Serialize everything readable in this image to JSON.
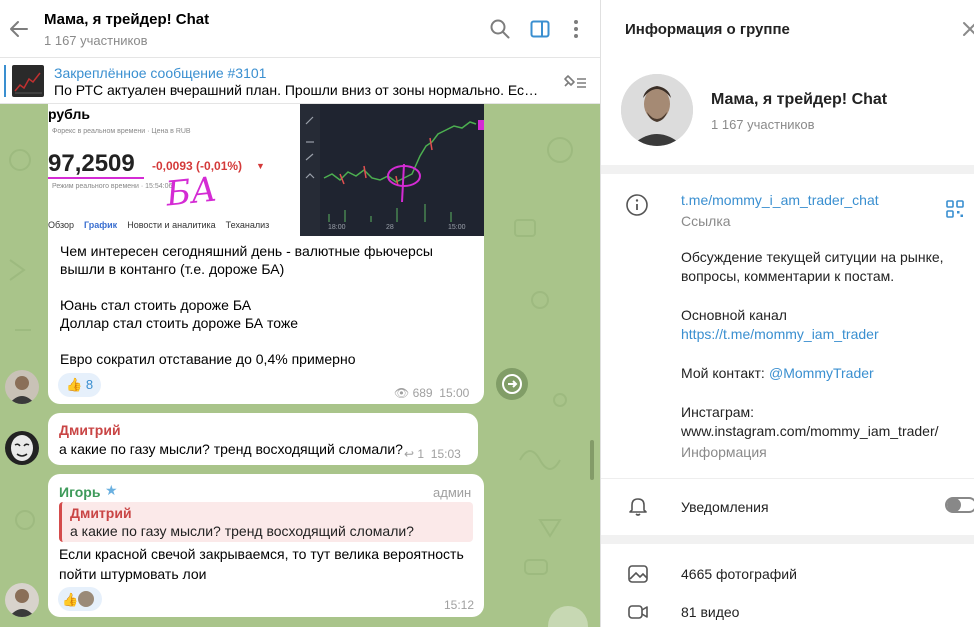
{
  "chat": {
    "title": "Мама, я трейдер! Chat",
    "members": "1 167 участников",
    "pinned": {
      "title": "Закреплённое сообщение #3101",
      "text": "По РТС актуален вчерашний план. Прошли вниз от зоны нормально. Если ..."
    },
    "messages": [
      {
        "screenshot": {
          "label_top": "рубль",
          "sub": "Форекс в реальном времени · Цена в RUB",
          "price": "97,2509",
          "change": "-0,0093 (-0,01%)",
          "realtime": "Режим реального времени · 15:54:06",
          "handwriting": "БА",
          "tabs": [
            "Обзор",
            "График",
            "Новости и аналитика",
            "Теханализ"
          ],
          "chart_x_labels": [
            "18:00",
            "28",
            "15:00"
          ]
        },
        "paragraphs": [
          "Чем интересен сегодняшний день - валютные фьючерсы вышли в контанго (т.е. дороже БА)",
          "Юань стал стоить дороже БА\nДоллар стал стоить дороже БА тоже",
          "Евро сократил отставание до 0,4% примерно"
        ],
        "reaction_count": "8",
        "views": "689",
        "time": "15:00"
      },
      {
        "sender": "Дмитрий",
        "text": "а какие по газу мысли? тренд восходящий сломали?",
        "replies": "1",
        "time": "15:03"
      },
      {
        "sender": "Игорь",
        "badge": "админ",
        "reply_to_sender": "Дмитрий",
        "reply_to_text": "а какие по газу мысли? тренд восходящий сломали?",
        "text": "Если красной свечой закрываемся, то тут велика вероятность пойти штурмовать лои",
        "time": "15:12"
      }
    ]
  },
  "info": {
    "header": "Информация о группе",
    "group_name": "Мама, я трейдер! Chat",
    "members": "1 167 участников",
    "link": "t.me/mommy_i_am_trader_chat",
    "link_label": "Ссылка",
    "description_line1": "Обсуждение текущей ситуции на рынке,",
    "description_line2": "вопросы, комментарии к постам.",
    "main_channel_label": "Основной канал",
    "main_channel_link": "https://t.me/mommy_iam_trader",
    "contact_label": "Мой контакт:",
    "contact_handle": "@MommyTrader",
    "instagram_label": "Инстаграм:",
    "instagram_url": "www.instagram.com/mommy_iam_trader/",
    "info_label": "Информация",
    "notifications": "Уведомления",
    "photos": "4665 фотографий",
    "videos": "81 видео"
  },
  "colors": {
    "accent": "#3a8fd0",
    "chat_bg": "#a9c48a",
    "sender_red": "#c94545",
    "sender_green": "#3e9a5a",
    "price_down": "#d43a3a",
    "handwriting": "#d42bd4"
  }
}
